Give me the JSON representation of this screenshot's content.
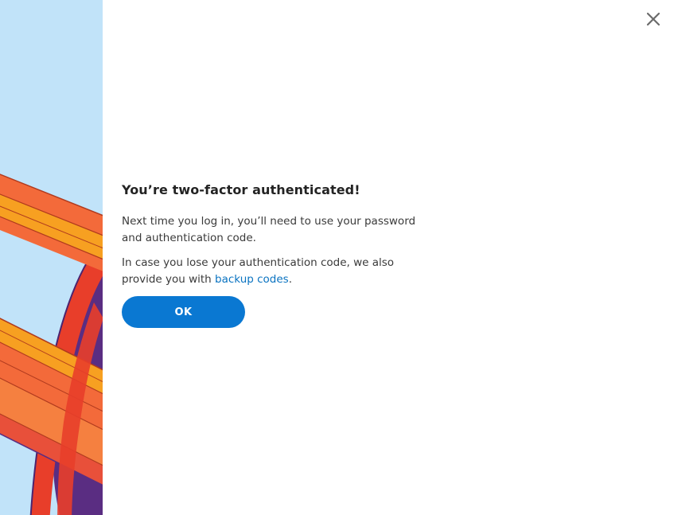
{
  "dialog": {
    "title": "You’re two-factor authenticated!",
    "paragraph1": "Next time you log in, you’ll need to use your password and authentication code.",
    "paragraph2_prefix": "In case you lose your authentication code, we also provide you with ",
    "paragraph2_link": "backup codes",
    "paragraph2_suffix": ".",
    "ok_label": "OK"
  },
  "icons": {
    "close": "close-icon",
    "illustration": "ribbon-illustration"
  },
  "colors": {
    "art_background": "#c1e3f9",
    "primary_button": "#0a78d2",
    "link": "#0a73c1",
    "close_icon": "#6b6b6b"
  }
}
